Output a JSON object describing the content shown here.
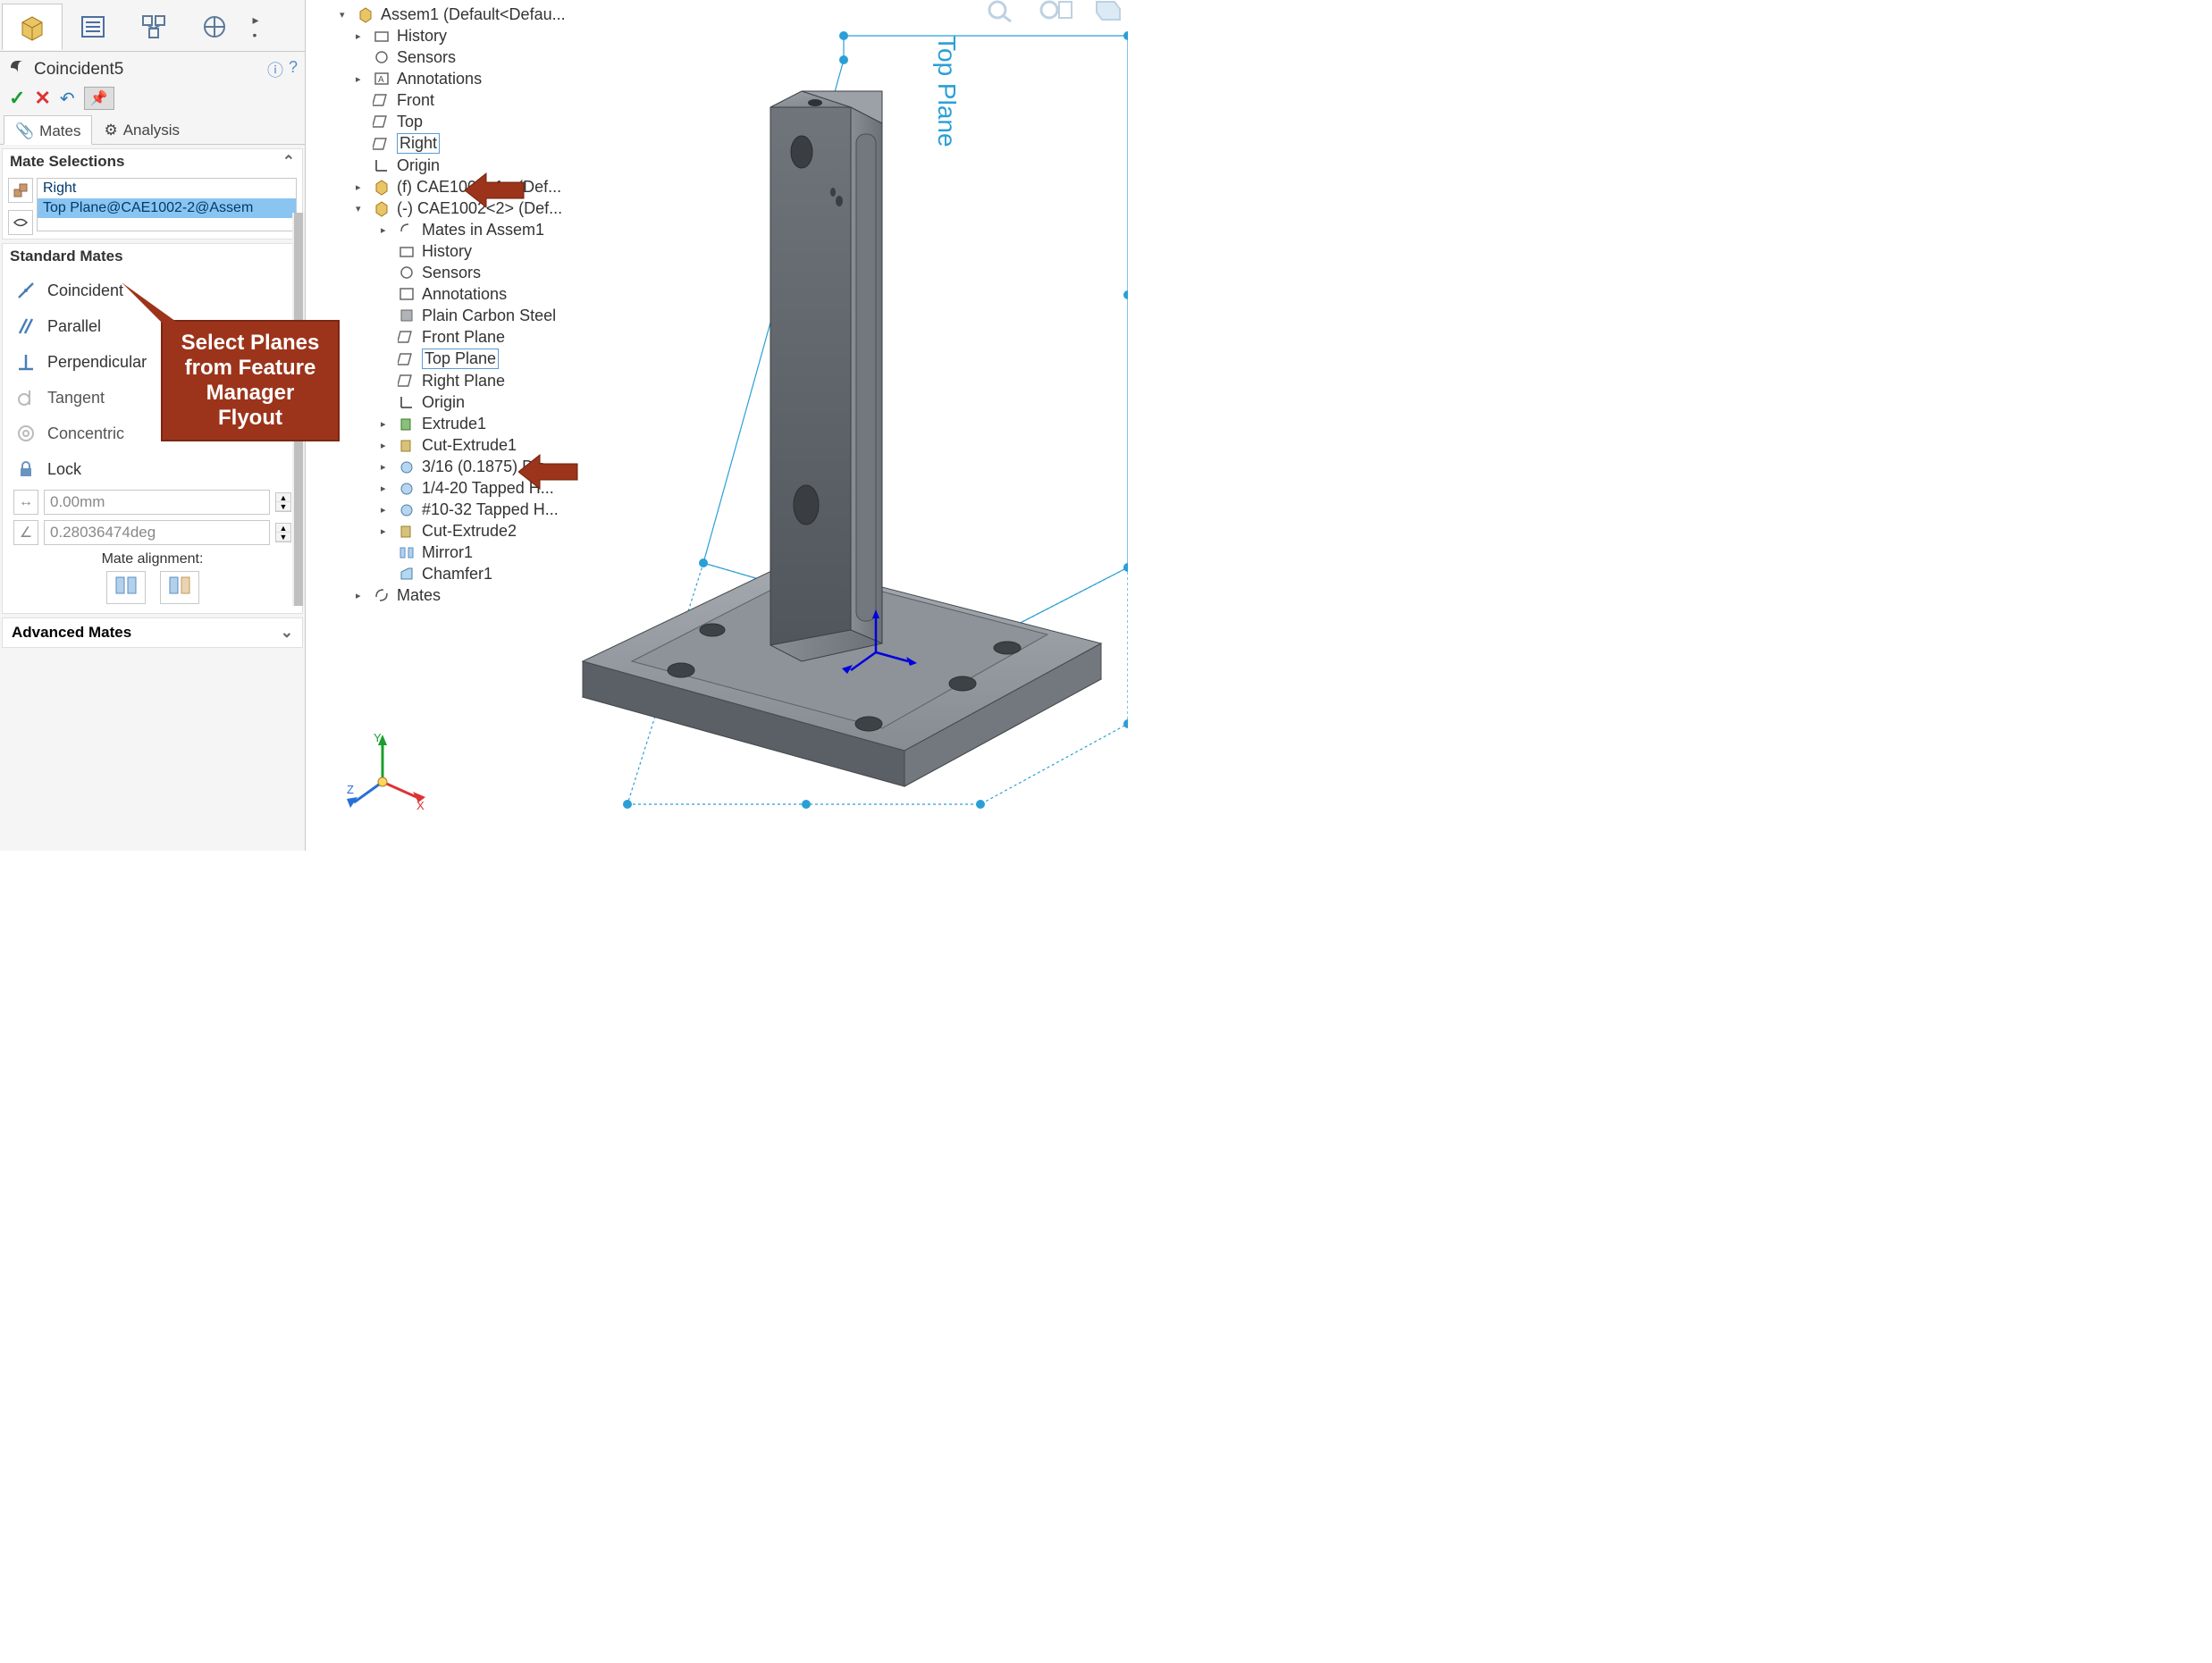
{
  "pm": {
    "title": "Coincident5",
    "tabs": {
      "mates": "Mates",
      "analysis": "Analysis"
    },
    "mate_selections_head": "Mate Selections",
    "selection1": "Right",
    "selection2": "Top Plane@CAE1002-2@Assem",
    "standard_head": "Standard Mates",
    "mate_coincident": "Coincident",
    "mate_parallel": "Parallel",
    "mate_perpendicular": "Perpendicular",
    "mate_tangent": "Tangent",
    "mate_concentric": "Concentric",
    "mate_lock": "Lock",
    "value_distance": "0.00mm",
    "value_angle": "0.28036474deg",
    "align_label": "Mate alignment:",
    "advanced_head": "Advanced Mates"
  },
  "tree": {
    "root": "Assem1  (Default<Defau...",
    "history": "History",
    "sensors": "Sensors",
    "annotations": "Annotations",
    "front": "Front",
    "top": "Top",
    "right": "Right",
    "origin": "Origin",
    "comp1": "(f) CAE1001<1> (Def...",
    "comp2": "(-) CAE1002<2> (Def...",
    "comp2_mates": "Mates in Assem1",
    "comp2_history": "History",
    "comp2_sensors": "Sensors",
    "comp2_annotations": "Annotations",
    "comp2_material": "Plain Carbon Steel",
    "comp2_front": "Front Plane",
    "comp2_top": "Top Plane",
    "comp2_right": "Right Plane",
    "comp2_origin": "Origin",
    "comp2_ext1": "Extrude1",
    "comp2_cut1": "Cut-Extrude1",
    "comp2_hw1": "3/16 (0.1875) Dia...",
    "comp2_hw2": "1/4-20 Tapped H...",
    "comp2_hw3": "#10-32 Tapped H...",
    "comp2_cut2": "Cut-Extrude2",
    "comp2_mirror": "Mirror1",
    "comp2_chamfer": "Chamfer1",
    "mates_folder": "Mates"
  },
  "viewport": {
    "plane_label": "Top Plane"
  },
  "callout": {
    "line1": "Select Planes",
    "line2": "from Feature",
    "line3": "Manager Flyout"
  }
}
